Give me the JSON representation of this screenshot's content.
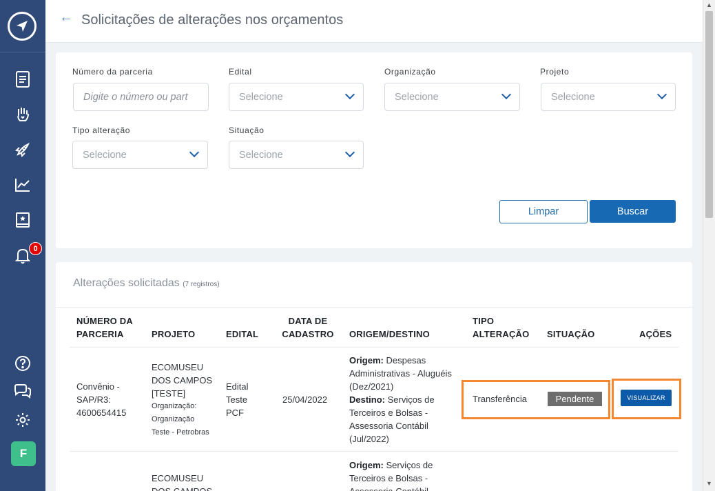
{
  "header": {
    "title": "Solicitações de alterações nos orçamentos"
  },
  "sidebar": {
    "notification_count": "0",
    "avatar_letter": "F",
    "items": [
      "document-icon",
      "hand-heart-icon",
      "rocket-icon",
      "chart-line-icon",
      "book-star-icon",
      "bell-icon",
      "help-icon",
      "chat-icon",
      "gear-icon"
    ]
  },
  "filters": {
    "numero_label": "Número da parceria",
    "numero_placeholder": "Digite o número ou part",
    "edital_label": "Edital",
    "organizacao_label": "Organização",
    "projeto_label": "Projeto",
    "tipo_label": "Tipo alteração",
    "situacao_label": "Situação",
    "select_placeholder": "Selecione",
    "clear_label": "Limpar",
    "search_label": "Buscar"
  },
  "table": {
    "title": "Alterações solicitadas",
    "count": "(7 registros)",
    "columns": {
      "numero": [
        "NÚMERO DA",
        "PARCERIA"
      ],
      "projeto": "PROJETO",
      "edital": "EDITAL",
      "data": [
        "DATA DE",
        "CADASTRO"
      ],
      "origem": "ORIGEM/DESTINO",
      "tipo": [
        "TIPO",
        "ALTERAÇÃO"
      ],
      "situacao": "SITUAÇÃO",
      "acoes": "AÇÕES"
    },
    "rows": [
      {
        "numero": [
          "Convênio -",
          "SAP/R3:",
          "4600654415"
        ],
        "projeto": [
          "ECOMUSEU",
          "DOS CAMPOS",
          "[TESTE]"
        ],
        "organizacao": [
          "Organização:",
          "Organização",
          "Teste - Petrobras"
        ],
        "edital": [
          "Edital",
          "Teste",
          "PCF"
        ],
        "data": "25/04/2022",
        "origem_label": "Origem:",
        "origem": [
          "Despesas",
          "Administrativas - Aluguéis",
          "(Dez/2021)"
        ],
        "destino_label": "Destino:",
        "destino": [
          "Serviços de",
          "Terceiros e Bolsas -",
          "Assessoria Contábil",
          "(Jul/2022)"
        ],
        "tipo": "Transferência",
        "situacao": "Pendente",
        "acao": "VISUALIZAR"
      },
      {
        "projeto": [
          "ECOMUSEU",
          "DOS CAMPOS"
        ],
        "origem_label": "Origem:",
        "origem": [
          "Serviços de",
          "Terceiros e Bolsas -",
          "Assessoria Contábil"
        ]
      }
    ]
  },
  "colors": {
    "sidebar": "#2f4a79",
    "primary": "#1869b3",
    "highlight": "#f5882f",
    "badge_red": "#e60000",
    "status_gray": "#6e6e6e"
  }
}
